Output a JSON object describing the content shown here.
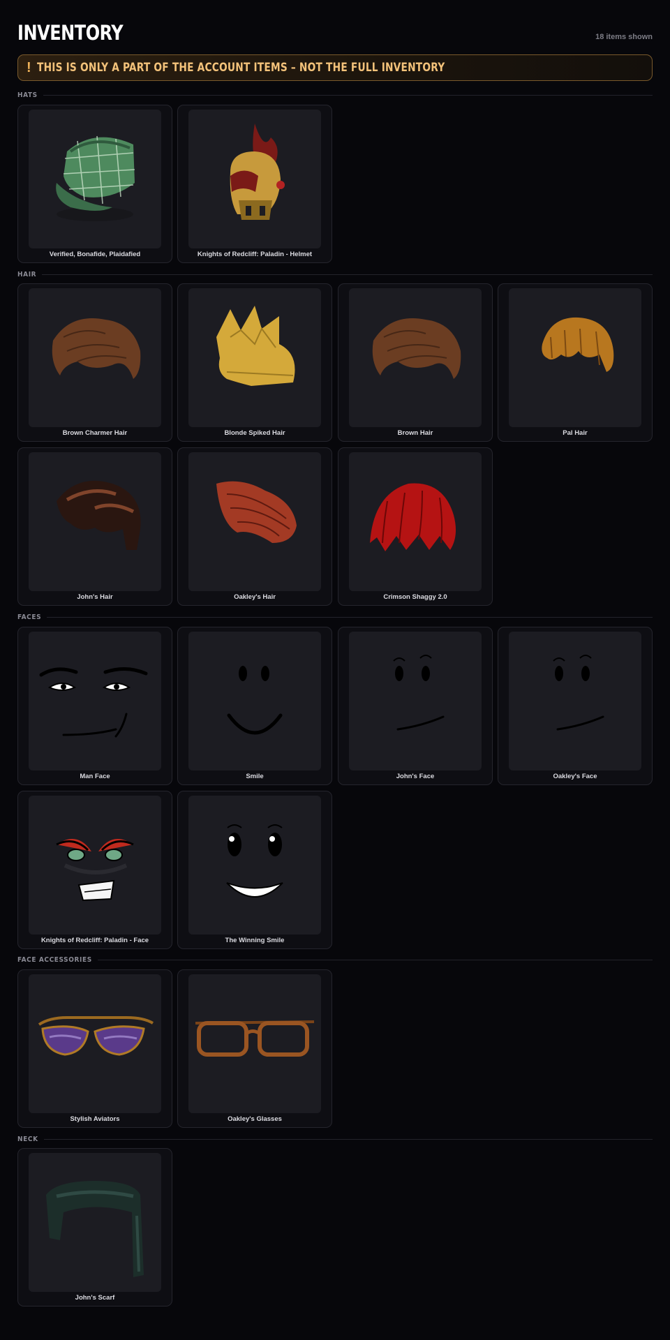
{
  "header": {
    "title": "INVENTORY",
    "count": "18 items shown"
  },
  "warning": {
    "icon": "exclamation-icon",
    "text": "THIS IS ONLY A PART OF THE ACCOUNT ITEMS – NOT THE FULL INVENTORY"
  },
  "sections": [
    {
      "label": "HATS",
      "items": [
        {
          "name": "Verified, Bonafide, Plaidafied",
          "icon": "plaid-cap-icon"
        },
        {
          "name": "Knights of Redcliff: Paladin - Helmet",
          "icon": "paladin-helmet-icon"
        }
      ]
    },
    {
      "label": "HAIR",
      "items": [
        {
          "name": "Brown Charmer Hair",
          "icon": "brown-hair-icon"
        },
        {
          "name": "Blonde Spiked Hair",
          "icon": "blonde-spiked-hair-icon"
        },
        {
          "name": "Brown Hair",
          "icon": "brown-hair-icon"
        },
        {
          "name": "Pal Hair",
          "icon": "pal-hair-icon"
        },
        {
          "name": "John's Hair",
          "icon": "dark-hair-icon"
        },
        {
          "name": "Oakley's Hair",
          "icon": "red-swept-hair-icon"
        },
        {
          "name": "Crimson Shaggy 2.0",
          "icon": "crimson-shaggy-hair-icon"
        }
      ]
    },
    {
      "label": "FACES",
      "items": [
        {
          "name": "Man Face",
          "icon": "man-face-icon"
        },
        {
          "name": "Smile",
          "icon": "smile-face-icon"
        },
        {
          "name": "John's Face",
          "icon": "smirk-face-icon"
        },
        {
          "name": "Oakley's Face",
          "icon": "smirk-face-icon"
        },
        {
          "name": "Knights of Redcliff: Paladin - Face",
          "icon": "paladin-face-icon"
        },
        {
          "name": "The Winning Smile",
          "icon": "winning-smile-face-icon"
        }
      ]
    },
    {
      "label": "FACE ACCESSORIES",
      "items": [
        {
          "name": "Stylish Aviators",
          "icon": "aviator-glasses-icon"
        },
        {
          "name": "Oakley's Glasses",
          "icon": "brown-glasses-icon"
        }
      ]
    },
    {
      "label": "NECK",
      "items": [
        {
          "name": "John's Scarf",
          "icon": "scarf-icon"
        }
      ]
    }
  ]
}
